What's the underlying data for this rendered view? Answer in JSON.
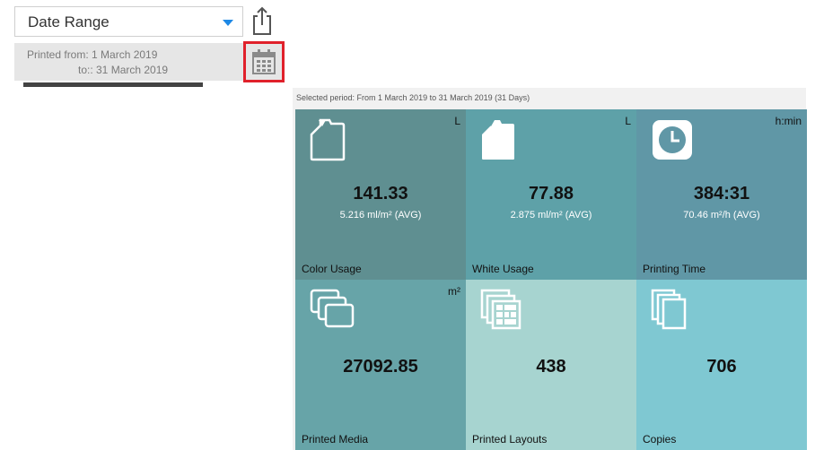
{
  "controls": {
    "date_range_label": "Date Range",
    "printed_from": "Printed from: 1 March 2019",
    "printed_to": "to:: 31 March 2019"
  },
  "dashboard": {
    "selected_period": "Selected period: From 1 March 2019 to 31 March 2019 (31 Days)",
    "tiles": [
      {
        "title": "Color Usage",
        "unit": "L",
        "value": "141.33",
        "sub": "5.216 ml/m² (AVG)",
        "icon": "ink-bottle-icon",
        "color": "#5f8f91"
      },
      {
        "title": "White Usage",
        "unit": "L",
        "value": "77.88",
        "sub": "2.875 ml/m² (AVG)",
        "icon": "ink-bottle-filled-icon",
        "color": "#5ea1a8"
      },
      {
        "title": "Printing Time",
        "unit": "h:min",
        "value": "384:31",
        "sub": "70.46 m²/h (AVG)",
        "icon": "clock-icon",
        "color": "#6097a6"
      },
      {
        "title": "Printed Media",
        "unit": "m²",
        "value": "27092.85",
        "sub": "",
        "icon": "media-stack-icon",
        "color": "#67a4a8"
      },
      {
        "title": "Printed Layouts",
        "unit": "",
        "value": "438",
        "sub": "",
        "icon": "layouts-stack-icon",
        "color": "#a7d4d0"
      },
      {
        "title": "Copies",
        "unit": "",
        "value": "706",
        "sub": "",
        "icon": "copies-stack-icon",
        "color": "#7fc8d2"
      }
    ]
  }
}
